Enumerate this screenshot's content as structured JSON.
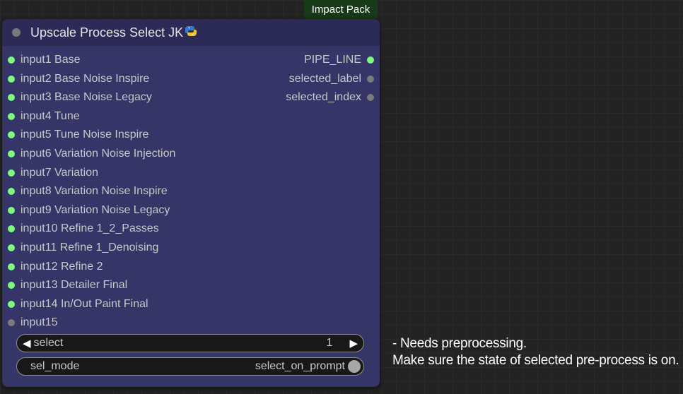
{
  "badge": {
    "label": "Impact Pack"
  },
  "node": {
    "title": "Upscale Process Select JK",
    "title_icon": "python-snake-icon"
  },
  "inputs": [
    {
      "label": "input1 Base",
      "connected": true
    },
    {
      "label": "input2 Base Noise Inspire",
      "connected": true
    },
    {
      "label": "input3 Base Noise Legacy",
      "connected": true
    },
    {
      "label": "input4 Tune",
      "connected": true
    },
    {
      "label": "input5 Tune Noise Inspire",
      "connected": true
    },
    {
      "label": "input6 Variation Noise Injection",
      "connected": true
    },
    {
      "label": "input7 Variation",
      "connected": true
    },
    {
      "label": "input8 Variation Noise Inspire",
      "connected": true
    },
    {
      "label": "input9 Variation Noise Legacy",
      "connected": true
    },
    {
      "label": "input10 Refine 1_2_Passes",
      "connected": true
    },
    {
      "label": "input11 Refine 1_Denoising",
      "connected": true
    },
    {
      "label": "input12 Refine 2",
      "connected": true
    },
    {
      "label": "input13 Detailer Final",
      "connected": true
    },
    {
      "label": "input14 In/Out Paint Final",
      "connected": true
    },
    {
      "label": "input15",
      "connected": false
    }
  ],
  "outputs": [
    {
      "label": "PIPE_LINE",
      "connected": true
    },
    {
      "label": "selected_label",
      "connected": false
    },
    {
      "label": "selected_index",
      "connected": false
    }
  ],
  "widgets": {
    "select": {
      "label": "select",
      "value": "1",
      "left_arrow": "◀",
      "right_arrow": "▶"
    },
    "sel_mode": {
      "label": "sel_mode",
      "value": "select_on_prompt",
      "toggle_on": false
    }
  },
  "note": {
    "line1": "- Needs preprocessing.",
    "line2": "Make sure the state of selected pre-process is on."
  },
  "colors": {
    "node_body": "#353567",
    "node_header": "#2c2b58",
    "slot_connected": "#7dfa7d",
    "slot_disconnected": "#7b7b7b",
    "badge_bg": "#173a17"
  }
}
